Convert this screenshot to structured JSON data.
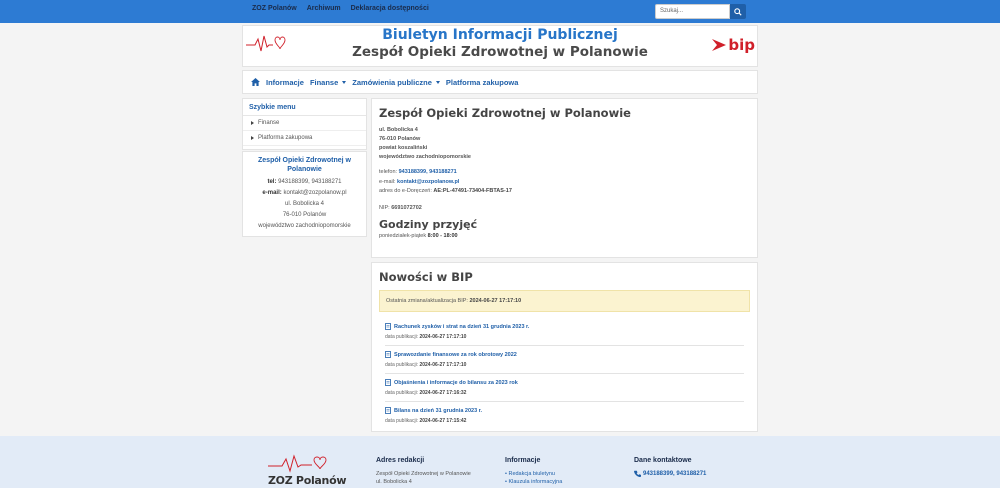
{
  "topbar": {
    "links": [
      "ZOZ Polanów",
      "Archiwum",
      "Deklaracja dostępności"
    ],
    "search_placeholder": "Szukaj..."
  },
  "header": {
    "title": "Biuletyn Informacji Publicznej",
    "subtitle": "Zespół Opieki Zdrowotnej w Polanowie",
    "bip_logo": "bip"
  },
  "nav": {
    "items": [
      {
        "label": "Informacje",
        "dropdown": false
      },
      {
        "label": "Finanse",
        "dropdown": true
      },
      {
        "label": "Zamówienia publiczne",
        "dropdown": true
      },
      {
        "label": "Platforma zakupowa",
        "dropdown": false
      }
    ]
  },
  "sidebar": {
    "quick_menu_title": "Szybkie menu",
    "quick_items": [
      "Finanse",
      "Platforma zakupowa"
    ],
    "org_name": "Zespół Opieki Zdrowotnej w Polanowie",
    "tel_label": "tel:",
    "tel_value": "943188399, 943188271",
    "email_label": "e-mail:",
    "email_value": "kontakt@zozpolanow.pl",
    "street": "ul. Bobolicka 4",
    "city": "76-010 Polanów",
    "region": "województwo zachodniopomorskie"
  },
  "main": {
    "title": "Zespół Opieki Zdrowotnej w Polanowie",
    "address": [
      "ul. Bobolicka 4",
      "76-010 Polanów",
      "powiat koszaliński",
      "województwo zachodniopomorskie"
    ],
    "phone_label": "telefon:",
    "phone_value": "943188399, 943188271",
    "email_label": "e-mail:",
    "email_value": "kontakt@zozpolanow.pl",
    "edelivery_label": "adres do e-Doręczeń:",
    "edelivery_value": "AE:PL-47491-73404-FBTAS-17",
    "nip_label": "NIP:",
    "nip_value": "6691072702",
    "hours_title": "Godziny przyjęć",
    "hours_label": "poniedziałek-piątek",
    "hours_value": "8:00 - 18:00"
  },
  "news": {
    "title": "Nowości w BIP",
    "last_change_label": "Ostatnia zmiana/aktualizacja BIP:",
    "last_change_value": "2024-06-27 17:17:10",
    "date_label": "data publikacji:",
    "items": [
      {
        "title": "Rachunek zysków i strat na dzień 31 grudnia 2023 r.",
        "date": "2024-06-27 17:17:10"
      },
      {
        "title": "Sprawozdanie finansowe za rok obrotowy 2022",
        "date": "2024-06-27 17:17:10"
      },
      {
        "title": "Objaśnienia i informacje do bilansu za 2023 rok",
        "date": "2024-06-27 17:16:32"
      },
      {
        "title": "Bilans na dzień 31 grudnia 2023 r.",
        "date": "2024-06-27 17:15:42"
      }
    ]
  },
  "footer": {
    "logo_name": "ZOZ Polanów",
    "col1_title": "Adres redakcji",
    "col1_lines": [
      "Zespół Opieki Zdrowotnej w Polanowie",
      "ul. Bobolicka 4"
    ],
    "col2_title": "Informacje",
    "col2_links": [
      "Redakcja biuletynu",
      "Klauzula informacyjna"
    ],
    "col3_title": "Dane kontaktowe",
    "col3_phone": "943188399, 943188271"
  },
  "colors": {
    "topbar": "#2d7bd3",
    "link_blue": "#1f5fa8",
    "bip_red": "#d0202a",
    "alert_bg": "#fbf3d0",
    "footer_bg": "#e2ebf7"
  }
}
